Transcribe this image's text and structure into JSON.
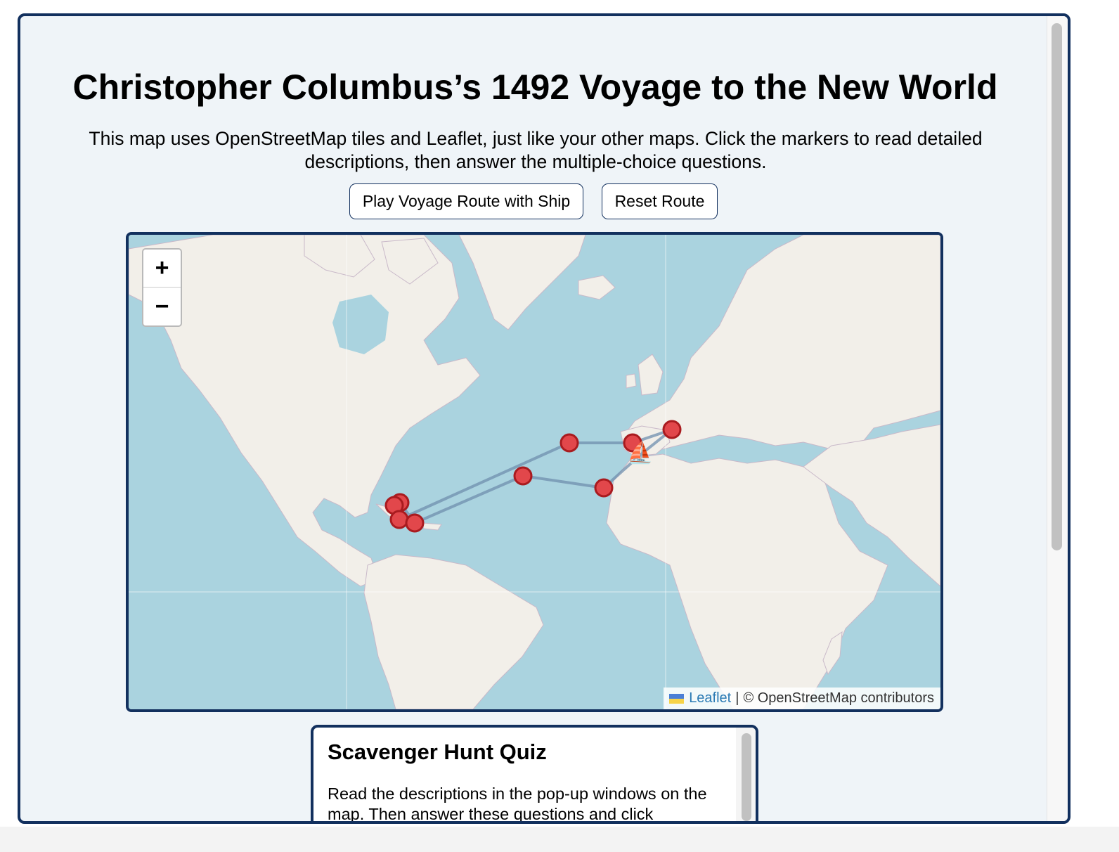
{
  "page": {
    "title": "Christopher Columbus’s 1492 Voyage to the New World",
    "intro": "This map uses OpenStreetMap tiles and Leaflet, just like your other maps. Click the markers to read detailed descriptions, then answer the multiple-choice questions."
  },
  "controls": {
    "play_label": "Play Voyage Route with Ship",
    "reset_label": "Reset Route"
  },
  "map": {
    "zoom_in": "+",
    "zoom_out": "−",
    "attribution_link": "Leaflet",
    "attribution_separator": "|",
    "attribution_text": "© OpenStreetMap contributors",
    "ship_icon": "⛵",
    "colors": {
      "water": "#aad3df",
      "land": "#f2efe9",
      "route": "#6f8fae",
      "marker_fill": "#e2474b",
      "marker_stroke": "#a91b1f",
      "frame": "#12305e"
    }
  },
  "quiz": {
    "title": "Scavenger Hunt Quiz",
    "intro": "Read the descriptions in the pop-up windows on the map. Then answer these questions and click"
  }
}
